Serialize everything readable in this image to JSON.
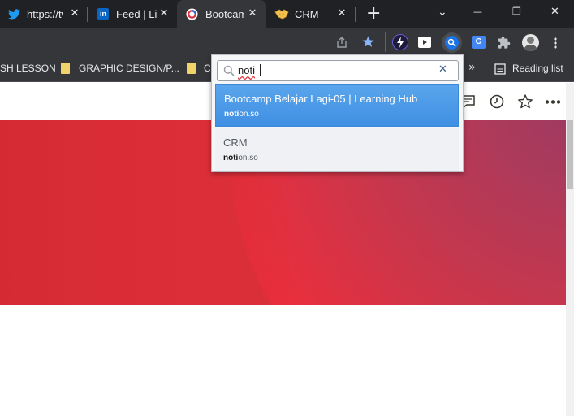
{
  "tabs": [
    {
      "label": "https://tw",
      "icon": "twitter-icon",
      "close": "✕"
    },
    {
      "label": "Feed | Lin",
      "icon": "linkedin-icon",
      "close": "✕"
    },
    {
      "label": "Bootcamp",
      "icon": "bootcamp-favicon-icon",
      "close": "✕",
      "active": true
    },
    {
      "label": "CRM",
      "icon": "handshake-icon",
      "close": "✕"
    }
  ],
  "new_tab": "+",
  "window_controls": {
    "tab_search": "⌄",
    "minimize": "—",
    "restore": "❐",
    "close": "✕"
  },
  "bookmarks": {
    "items": [
      "SH LESSON",
      "GRAPHIC DESIGN/P...",
      "C"
    ],
    "overflow": "»",
    "reading_list": "Reading list"
  },
  "search_popup": {
    "query": "noti",
    "clear": "✕",
    "results": [
      {
        "title": "Bootcamp Belajar Lagi-05 | Learning Hub",
        "url_match": "noti",
        "url_rest": "on.so"
      },
      {
        "title": "CRM",
        "url_match": "noti",
        "url_rest": "on.so"
      }
    ]
  },
  "colors": {
    "tabstrip": "#202124",
    "toolbar": "#35363a",
    "highlight": "#4a98e8",
    "banner_red": "#e32a36",
    "banner_purple": "#9a3b64"
  }
}
